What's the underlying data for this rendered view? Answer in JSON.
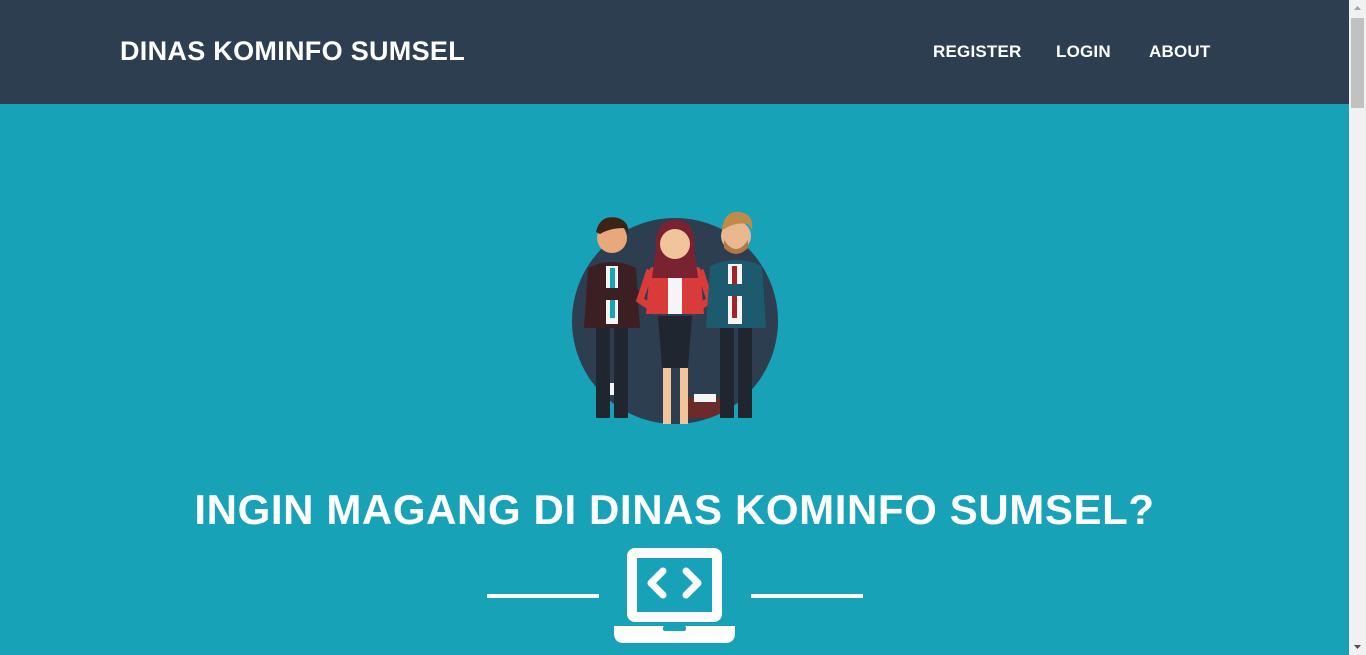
{
  "navbar": {
    "brand": "DINAS KOMINFO SUMSEL",
    "links": [
      {
        "label": "REGISTER"
      },
      {
        "label": "LOGIN"
      },
      {
        "label": "ABOUT"
      }
    ]
  },
  "masthead": {
    "avatar_icon": "team-illustration-icon",
    "headline": "INGIN MAGANG DI DINAS KOMINFO SUMSEL?",
    "divider_icon": "laptop-code-icon"
  },
  "colors": {
    "navbar_bg": "#2c3e50",
    "masthead_bg": "#18a2b8",
    "text": "#ffffff",
    "avatar_circle": "#2c3e50"
  }
}
